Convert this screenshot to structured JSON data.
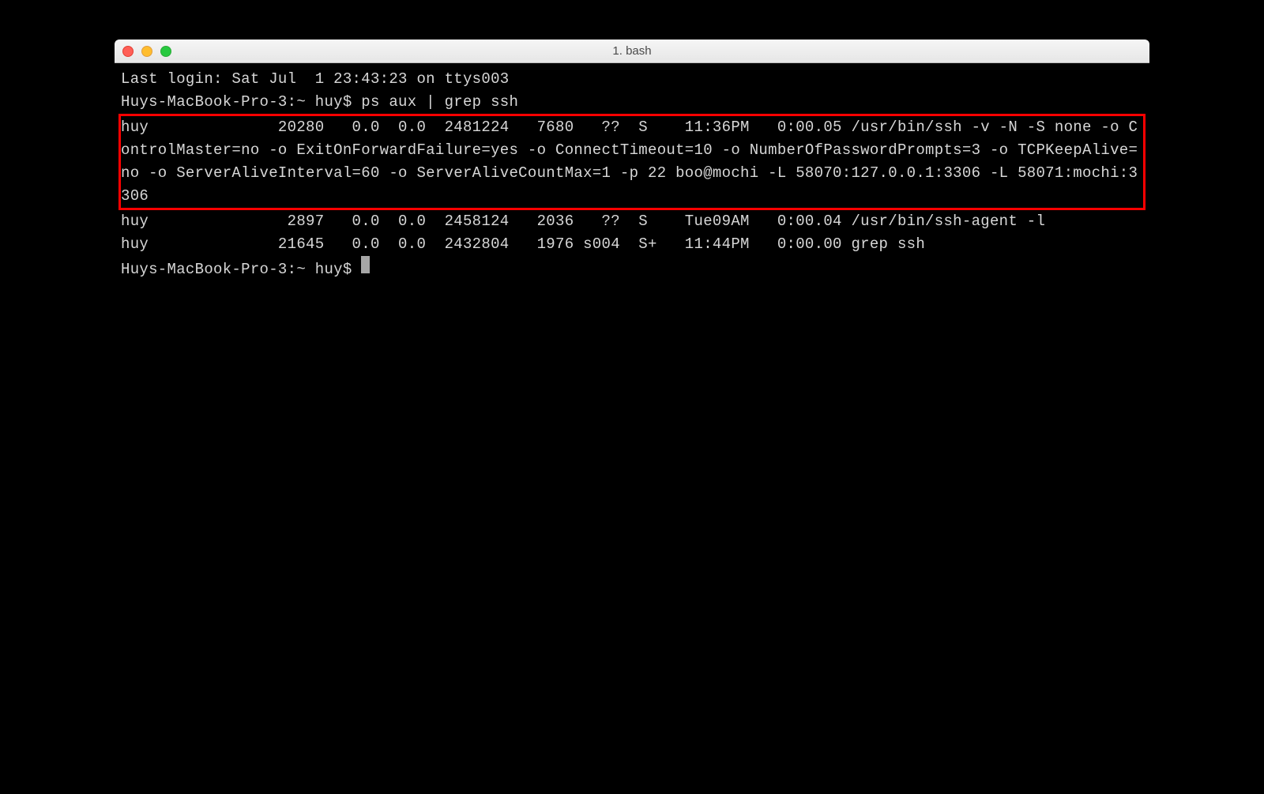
{
  "window": {
    "title": "1. bash"
  },
  "terminal": {
    "login_line": "Last login: Sat Jul  1 23:43:23 on ttys003",
    "prompt1": "Huys-MacBook-Pro-3:~ huy$ ps aux | grep ssh",
    "highlighted_output": "huy              20280   0.0  0.0  2481224   7680   ??  S    11:36PM   0:00.05 /usr/bin/ssh -v -N -S none -o ControlMaster=no -o ExitOnForwardFailure=yes -o ConnectTimeout=10 -o NumberOfPasswordPrompts=3 -o TCPKeepAlive=no -o ServerAliveInterval=60 -o ServerAliveCountMax=1 -p 22 boo@mochi -L 58070:127.0.0.1:3306 -L 58071:mochi:3306",
    "output_line2": "huy               2897   0.0  0.0  2458124   2036   ??  S    Tue09AM   0:00.04 /usr/bin/ssh-agent -l",
    "output_line3": "huy              21645   0.0  0.0  2432804   1976 s004  S+   11:44PM   0:00.00 grep ssh",
    "prompt2": "Huys-MacBook-Pro-3:~ huy$ "
  }
}
